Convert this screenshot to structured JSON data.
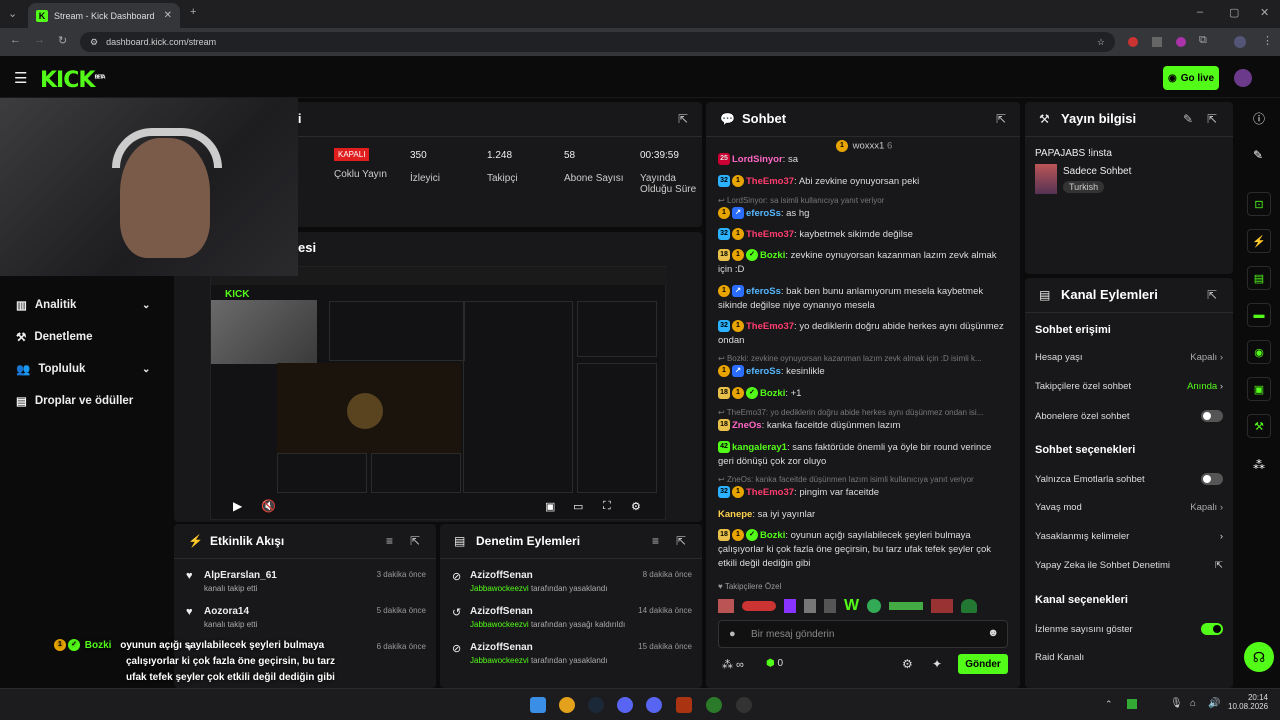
{
  "browser": {
    "tab_title": "Stream - Kick Dashboard",
    "url": "dashboard.kick.com/stream"
  },
  "header": {
    "logo": "KICK",
    "logo_badge": "BETA",
    "go_live": "Go live"
  },
  "stats": {
    "title_partial": "leri",
    "status_badge": "KAPALI",
    "status_label": "Çoklu Yayın",
    "clip_label_partial": "k",
    "items": [
      {
        "value": "350",
        "label": "İzleyici"
      },
      {
        "value": "1.248",
        "label": "Takipçi"
      },
      {
        "value": "58",
        "label": "Abone Sayısı"
      },
      {
        "value": "00:39:59",
        "label": "Yayında Olduğu Süre"
      }
    ]
  },
  "preview": {
    "title_partial": "esi"
  },
  "nav": {
    "items": [
      {
        "label": "Analitik",
        "icon": "chart-icon"
      },
      {
        "label": "Denetleme",
        "icon": "wrench-icon"
      },
      {
        "label": "Topluluk",
        "icon": "users-icon"
      },
      {
        "label": "Droplar ve ödüller",
        "icon": "gift-icon"
      }
    ]
  },
  "events": {
    "title": "Etkinlik Akışı",
    "rows": [
      {
        "name": "AlpErarslan_61",
        "sub": "kanalı takip etti",
        "time": "3 dakika önce"
      },
      {
        "name": "Aozora14",
        "sub": "kanalı takip etti",
        "time": "5 dakika önce"
      },
      {
        "name": "",
        "sub": "",
        "time": "6 dakika önce"
      }
    ]
  },
  "moderation": {
    "title": "Denetim Eylemleri",
    "rows": [
      {
        "name": "AzizoffSenan",
        "by": "Jabbawockeezvi",
        "sub": "tarafından yasaklandı",
        "time": "8 dakika önce"
      },
      {
        "name": "AzizoffSenan",
        "by": "Jabbawockeezvi",
        "sub": "tarafından yasağı kaldırıldı",
        "time": "14 dakika önce"
      },
      {
        "name": "AzizoffSenan",
        "by": "Jabbawockeezvi",
        "sub": "tarafından yasaklandı",
        "time": "15 dakika önce"
      }
    ]
  },
  "chat": {
    "title": "Sohbet",
    "pinned_user": "woxxx1",
    "pinned_count": "6",
    "followers_only": "Takipçilere Özel",
    "input_placeholder": "Bir mesaj gönderin",
    "points": "0",
    "send_label": "Gönder",
    "messages": [
      {
        "user": "LordSinyor",
        "text": "sa",
        "color": "pink"
      },
      {
        "user": "TheEmo37",
        "text": "Abi zevkine oynuyorsan peki",
        "color": "red"
      },
      {
        "reply": "LordSinyor: sa isimli kullanıcıya yanıt veriyor"
      },
      {
        "user": "eferoSs",
        "text": "as hg",
        "color": "blue"
      },
      {
        "user": "TheEmo37",
        "text": "kaybetmek sikimde değilse",
        "color": "red"
      },
      {
        "user": "Bozki",
        "text": "zevkine oynuyorsan kazanman lazım zevk almak için :D",
        "color": "green"
      },
      {
        "user": "eferoSs",
        "text": "bak ben bunu anlamıyorum mesela kaybetmek sikinde değilse niye oynanıyo mesela",
        "color": "blue"
      },
      {
        "user": "TheEmo37",
        "text": "yo dediklerin doğru abide herkes aynı düşünmez ondan",
        "color": "red"
      },
      {
        "reply": "Bozki: zevkine oynuyorsan kazanman lazım zevk almak için :D isimli k..."
      },
      {
        "user": "eferoSs",
        "text": "kesinlikle",
        "color": "blue"
      },
      {
        "user": "Bozki",
        "text": "+1",
        "color": "green"
      },
      {
        "reply": "TheEmo37: yo dediklerin doğru abide herkes aynı düşünmez ondan isi..."
      },
      {
        "user": "ZneOs",
        "text": "kanka faceitde düşünmen lazım",
        "color": "pink"
      },
      {
        "user": "kangaleray1",
        "text": "sans faktörüde önemli ya öyle bir round verince geri dönüşü çok zor oluyo",
        "color": "green"
      },
      {
        "reply": "ZneOs: kanka faceitde düşünmen lazım isimli kullanıcıya yanıt veriyor"
      },
      {
        "user": "TheEmo37",
        "text": "pingim var faceitde",
        "color": "red"
      },
      {
        "user": "Kanepe",
        "text": "sa iyi yayınlar",
        "color": "yellow"
      },
      {
        "user": "Bozki",
        "text": "oyunun açığı sayılabilecek şeyleri bulmaya çalışıyorlar ki çok fazla öne geçirsin, bu tarz ufak tefek şeyler çok etkili değil dediğin gibi",
        "color": "green"
      }
    ]
  },
  "stream_info": {
    "title": "Yayın bilgisi",
    "stream_title": "PAPAJABS !insta",
    "category": "Sadece Sohbet",
    "tag": "Turkish"
  },
  "channel_actions": {
    "title": "Kanal Eylemleri",
    "sections": [
      {
        "heading": "Sohbet erişimi"
      },
      {
        "label": "Hesap yaşı",
        "value": "Kapalı"
      },
      {
        "label": "Takipçilere özel sohbet",
        "value": "Anında"
      },
      {
        "label": "Abonelere özel sohbet",
        "toggle": false
      },
      {
        "heading": "Sohbet seçenekleri"
      },
      {
        "label": "Yalnızca Emotlarla sohbet",
        "toggle": false
      },
      {
        "label": "Yavaş mod",
        "value": "Kapalı"
      },
      {
        "label": "Yasaklanmış kelimeler"
      },
      {
        "label": "Yapay Zeka ile Sohbet Denetimi"
      },
      {
        "heading": "Kanal seçenekleri"
      },
      {
        "label": "İzlenme sayısını göster",
        "toggle": true
      },
      {
        "label": "Raid Kanalı"
      }
    ]
  },
  "overlay": {
    "user": "Bozki",
    "line1": "oyunun açığı sayılabilecek şeyleri bulmaya",
    "line2": "çalışıyorlar ki çok fazla öne geçirsin, bu tarz",
    "line3": "ufak tefek şeyler çok etkili değil dediğin gibi"
  },
  "taskbar": {
    "time": "20:14",
    "date": "10.08.2026"
  },
  "colors": {
    "accent": "#53fc18",
    "panel": "#18181a",
    "bg": "#0b0b0c"
  }
}
